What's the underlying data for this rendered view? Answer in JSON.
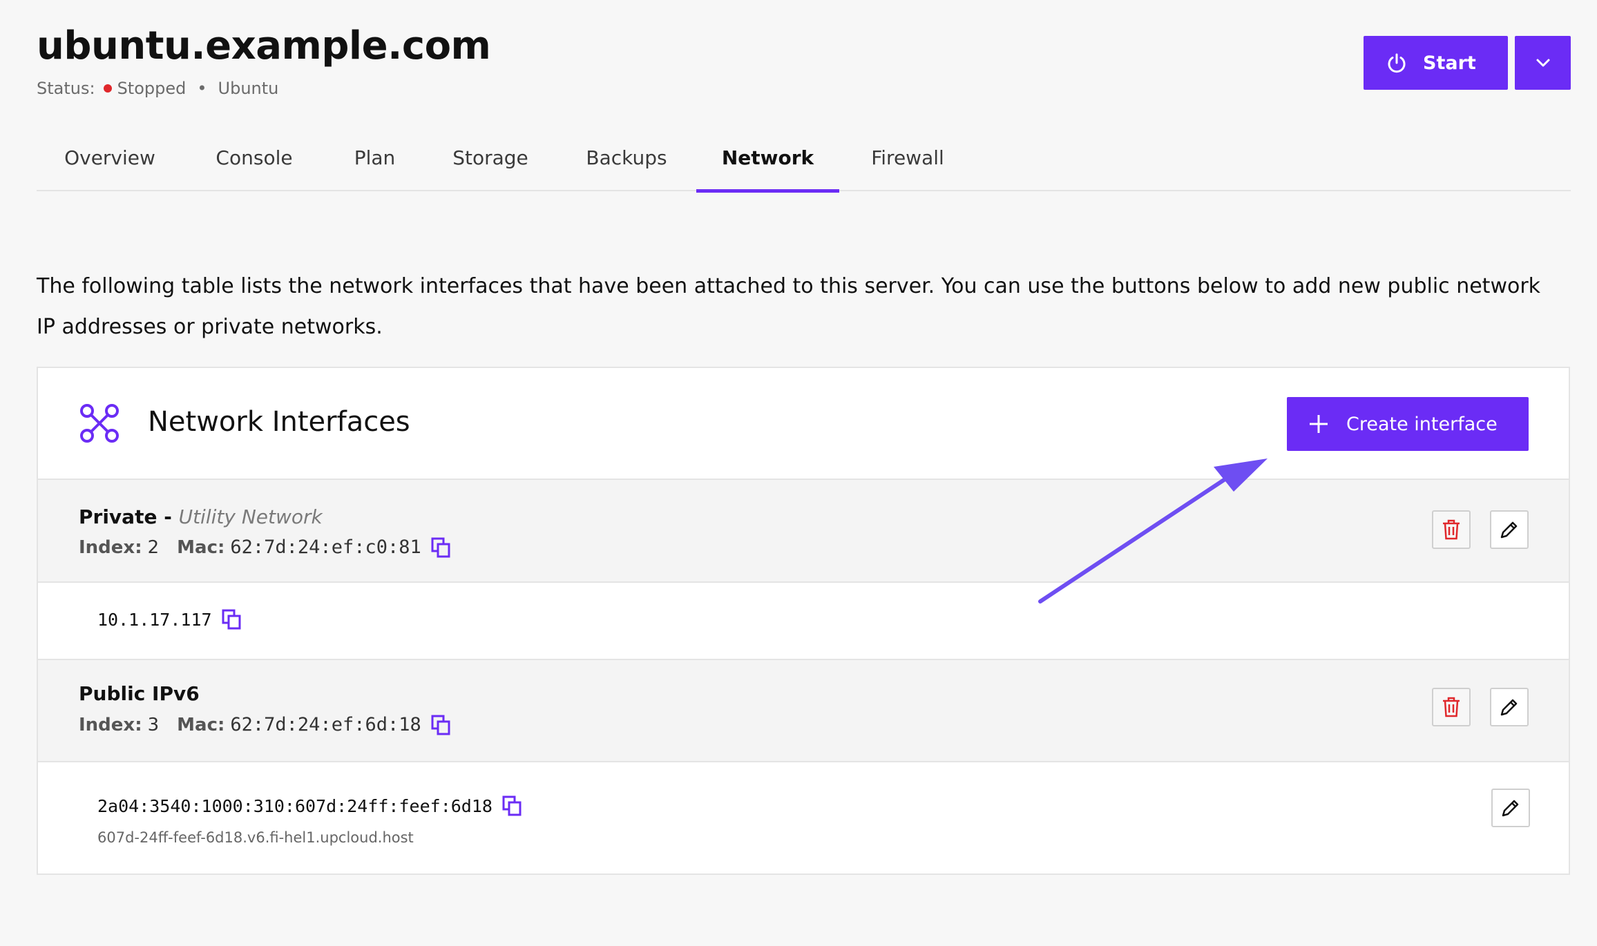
{
  "header": {
    "title": "ubuntu.example.com",
    "status_label": "Status:",
    "status_value": "Stopped",
    "separator": "•",
    "os": "Ubuntu",
    "status_color": "#e0272b"
  },
  "actions": {
    "start_label": "Start"
  },
  "tabs": [
    {
      "label": "Overview"
    },
    {
      "label": "Console"
    },
    {
      "label": "Plan"
    },
    {
      "label": "Storage"
    },
    {
      "label": "Backups"
    },
    {
      "label": "Network",
      "active": true
    },
    {
      "label": "Firewall"
    }
  ],
  "description": "The following table lists the network interfaces that have been attached to this server. You can use the buttons below to add new public network IP addresses or private networks.",
  "card": {
    "title": "Network Interfaces",
    "create_label": "Create interface",
    "interfaces": [
      {
        "name": "Private - ",
        "network": "Utility Network",
        "index_label": "Index:",
        "index": "2",
        "mac_label": "Mac:",
        "mac": "62:7d:24:ef:c0:81",
        "ip": "10.1.17.117"
      },
      {
        "name": "Public IPv6",
        "index_label": "Index:",
        "index": "3",
        "mac_label": "Mac:",
        "mac": "62:7d:24:ef:6d:18",
        "ip": "2a04:3540:1000:310:607d:24ff:feef:6d18",
        "hostname": "607d-24ff-feef-6d18.v6.fi-hel1.upcloud.host"
      }
    ]
  },
  "colors": {
    "accent": "#6b2cf5",
    "arrow": "#6e4ef2",
    "delete": "#e0272b"
  }
}
